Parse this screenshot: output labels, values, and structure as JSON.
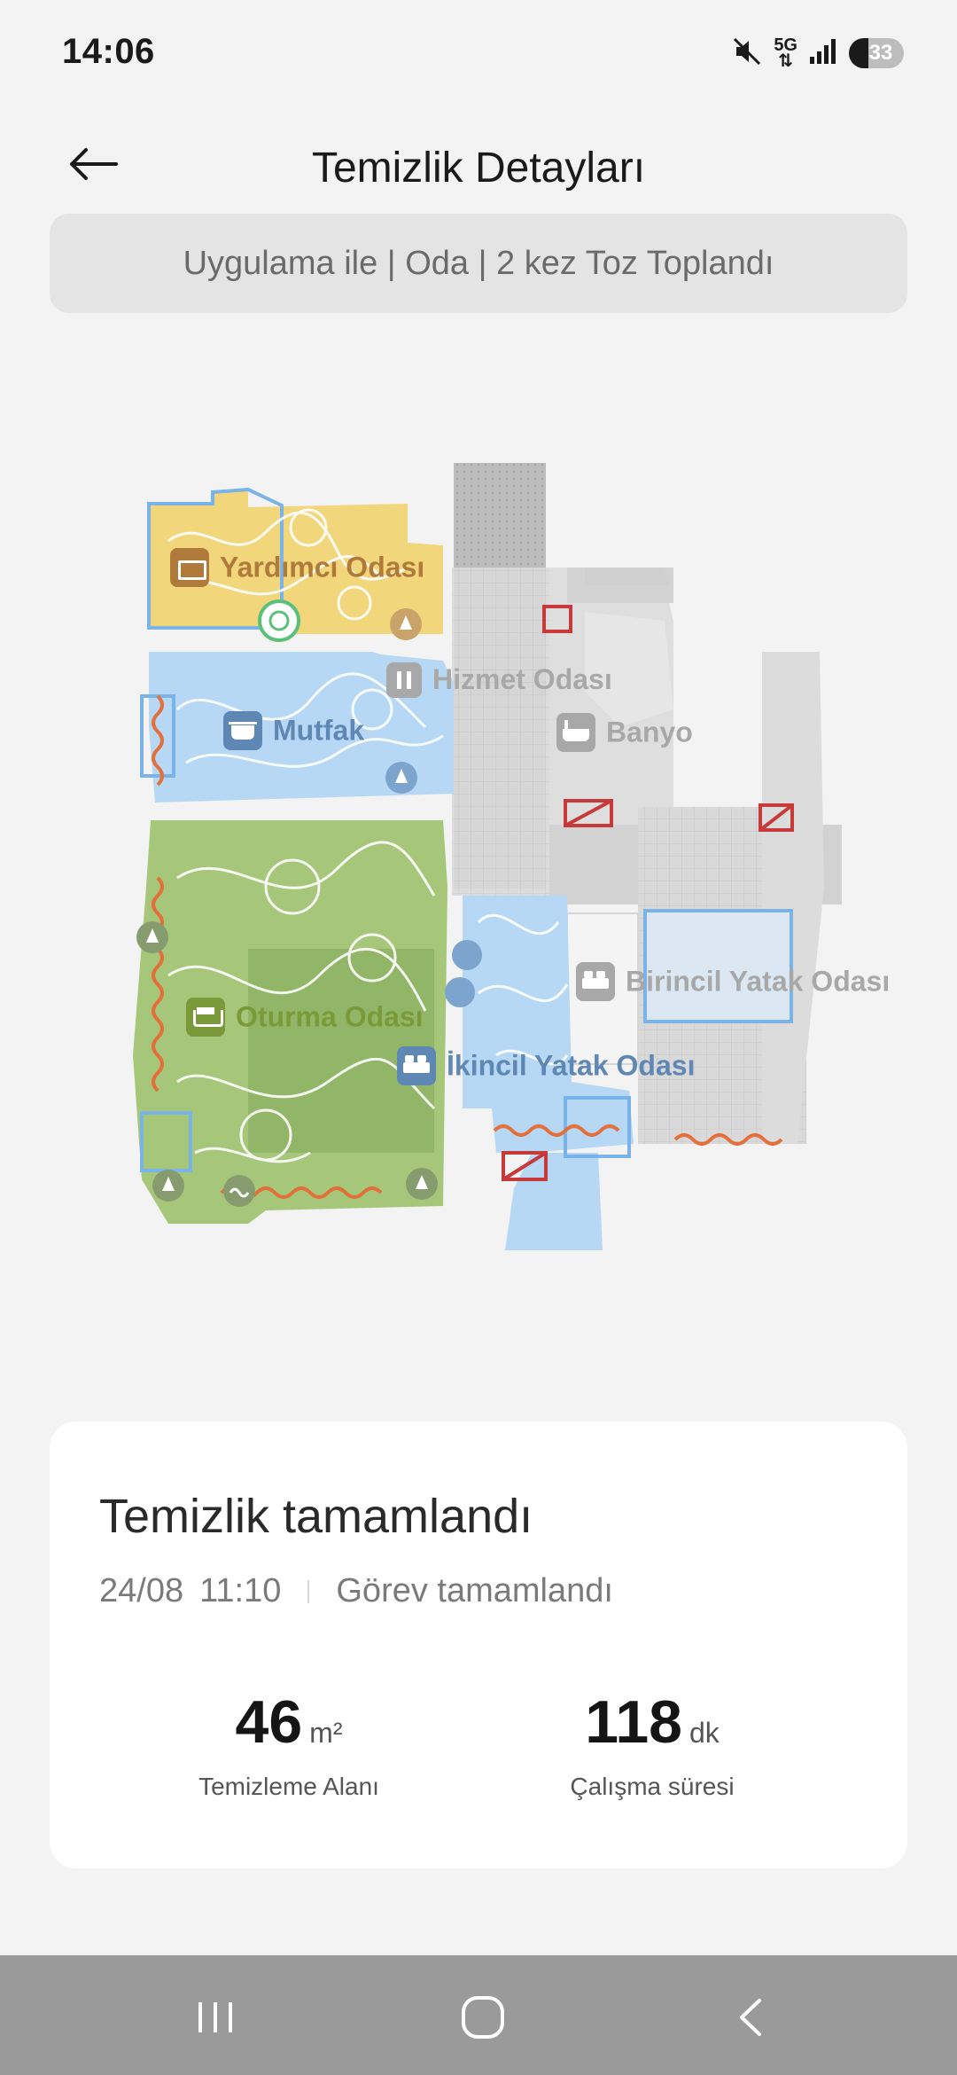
{
  "status_bar": {
    "time": "14:06",
    "network": "5G",
    "battery": "33",
    "icons": [
      "mute-icon",
      "5g-icon",
      "signal-icon",
      "battery-icon"
    ]
  },
  "header": {
    "back_icon": "arrow-left-icon",
    "title": "Temizlik Detayları"
  },
  "summary_chip": {
    "text": "Uygulama ile | Oda | 2 kez Toz Toplandı"
  },
  "map": {
    "rooms": [
      {
        "name": "Yardımcı Odası",
        "icon": "storage-icon",
        "color": "#b07a3a"
      },
      {
        "name": "Hizmet Odası",
        "icon": "service-icon",
        "color": "#a8a8a8"
      },
      {
        "name": "Mutfak",
        "icon": "cooking-pot-icon",
        "color": "#5f87b3"
      },
      {
        "name": "Banyo",
        "icon": "bathtub-icon",
        "color": "#a8a8a8"
      },
      {
        "name": "Oturma Odası",
        "icon": "sofa-icon",
        "color": "#7a9a3a"
      },
      {
        "name": "Birincil Yatak Odası",
        "icon": "bed-icon",
        "color": "#a8a8a8"
      },
      {
        "name": "İkincil Yatak Odası",
        "icon": "bed-icon",
        "color": "#5f87b3"
      }
    ],
    "colors": {
      "yellow_room": "#f2d67c",
      "blue_room": "#b6d8f5",
      "green_room": "#a6c77a",
      "grey_room": "#d6d6d6",
      "no_go_zone": "#c83a3a",
      "carpet_edge": "#e36f3a",
      "boundary": "#79b3e8"
    }
  },
  "result_card": {
    "title": "Temizlik tamamlandı",
    "date": "24/08",
    "time": "11:10",
    "status": "Görev tamamlandı",
    "area_value": "46",
    "area_unit": "m²",
    "area_label": "Temizleme Alanı",
    "duration_value": "118",
    "duration_unit": "dk",
    "duration_label": "Çalışma süresi"
  },
  "nav_bar": {
    "recents_icon": "recents-icon",
    "home_icon": "home-icon",
    "back_icon": "nav-back-icon"
  }
}
